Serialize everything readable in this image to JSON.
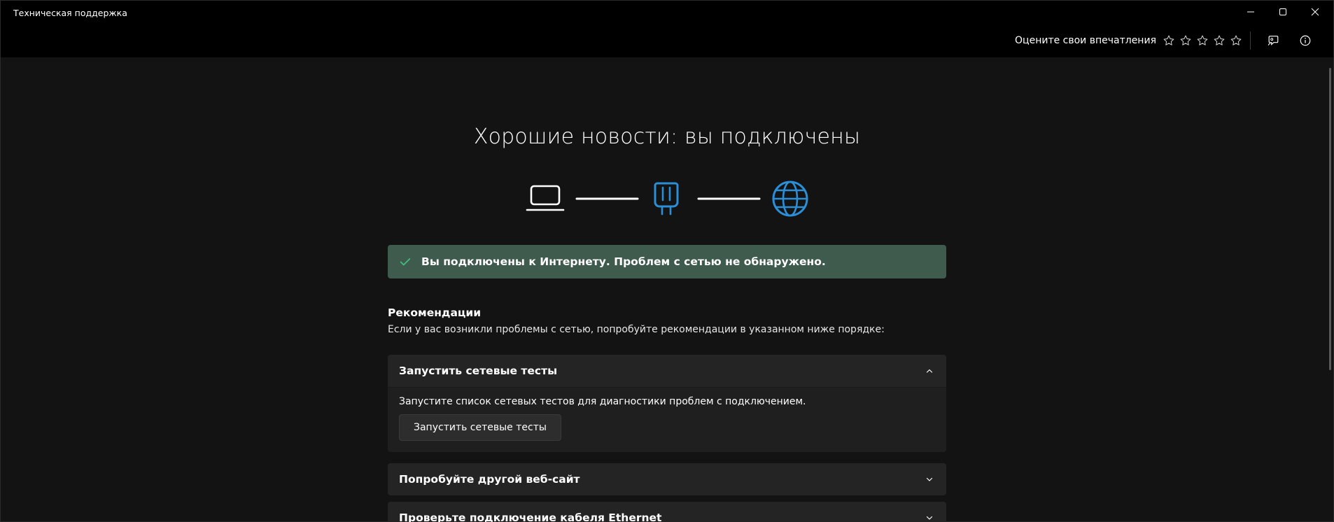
{
  "window": {
    "title": "Техническая поддержка"
  },
  "toolbar": {
    "rate_label": "Оцените свои впечатления",
    "stars_count": 5,
    "feedback_icon": "feedback-icon",
    "info_icon": "info-icon"
  },
  "main": {
    "headline": "Хорошие новости: вы подключены",
    "status_message": "Вы подключены к Интернету. Проблем с сетью не обнаружено.",
    "recommendations_title": "Рекомендации",
    "recommendations_desc": "Если у вас возникли проблемы с сетью, попробуйте рекомендации в указанном ниже порядке:",
    "cards": [
      {
        "title": "Запустить сетевые тесты",
        "expanded": true,
        "body": "Запустите список сетевых тестов для диагностики проблем с подключением.",
        "button_label": "Запустить сетевые тесты"
      },
      {
        "title": "Попробуйте другой веб-сайт",
        "expanded": false
      },
      {
        "title": "Проверьте подключение кабеля Ethernet",
        "expanded": false
      }
    ]
  },
  "colors": {
    "accent_blue": "#2b8fd8",
    "success_green": "#3fbf7f",
    "status_bg": "#3f5b4d"
  }
}
